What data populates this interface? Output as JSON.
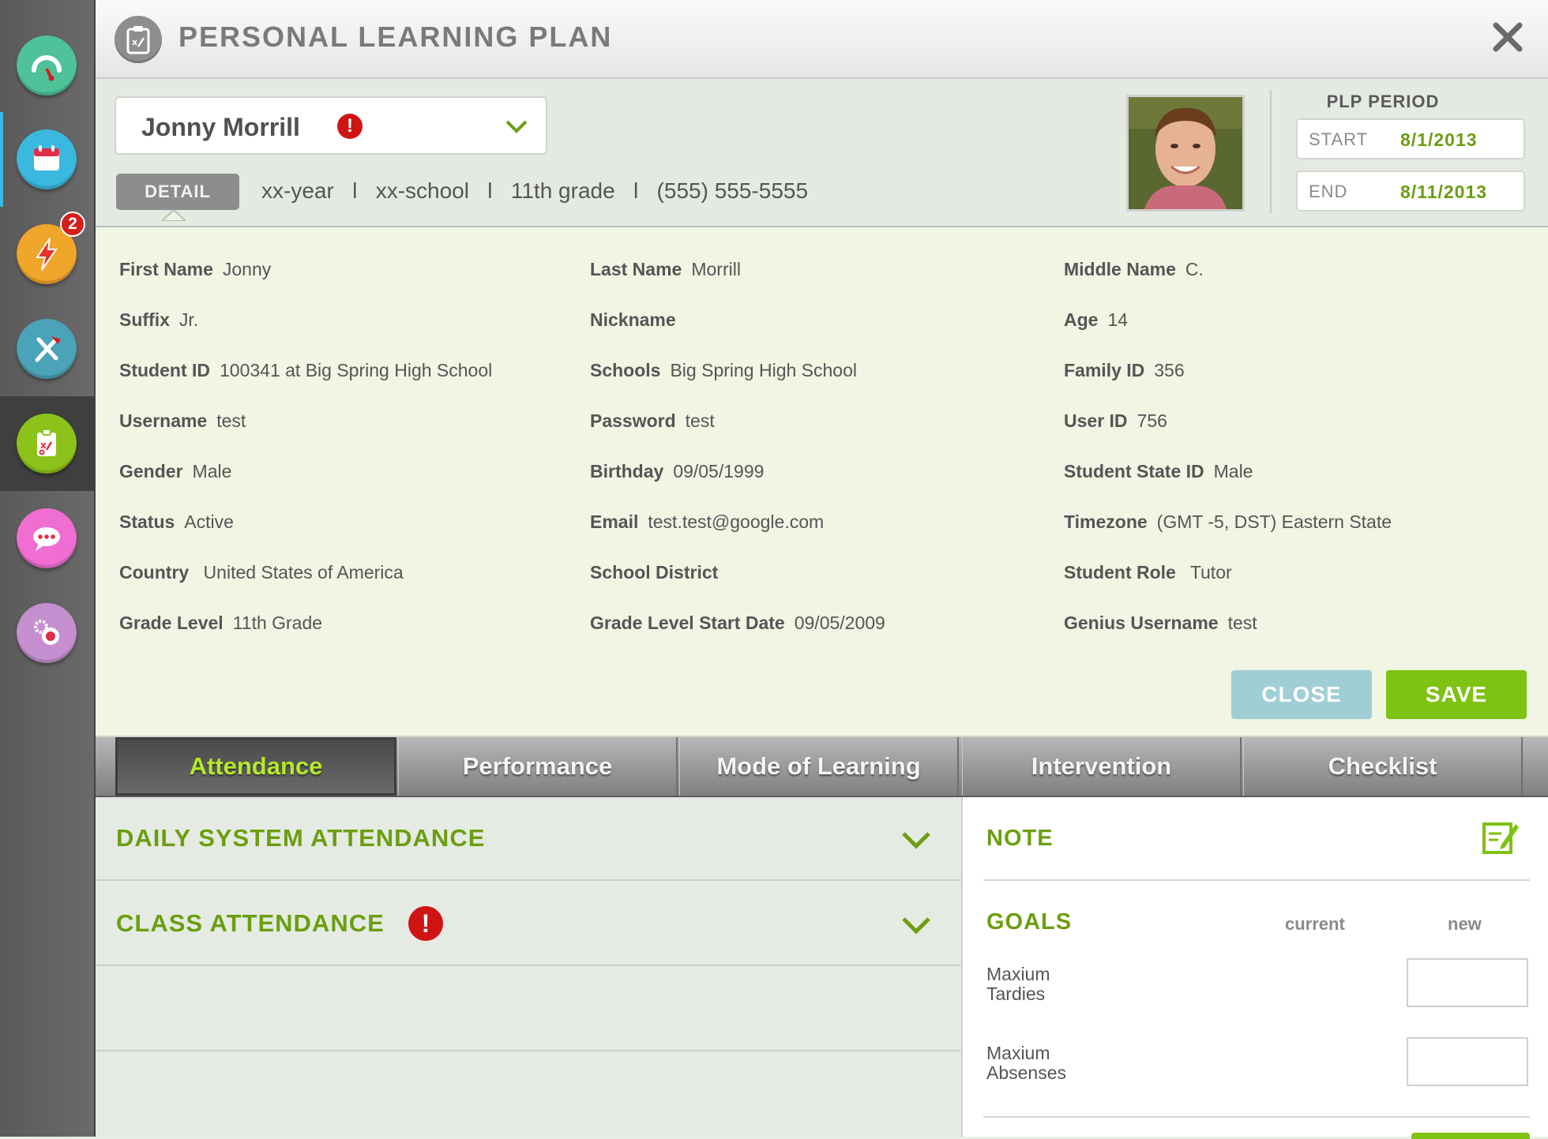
{
  "header": {
    "title": "PERSONAL LEARNING PLAN"
  },
  "sidebar": {
    "items": [
      {
        "name": "dashboard-gauge-icon",
        "color": "#4fc29a"
      },
      {
        "name": "calendar-icon",
        "color": "#3bb8e0"
      },
      {
        "name": "alerts-lightning-icon",
        "color": "#f0a52b",
        "badge": "2"
      },
      {
        "name": "tools-icon",
        "color": "#4aa3b8"
      },
      {
        "name": "plan-clipboard-icon",
        "color": "#8cc21a"
      },
      {
        "name": "chat-icon",
        "color": "#f06ed2"
      },
      {
        "name": "settings-gears-icon",
        "color": "#c58fd0"
      }
    ]
  },
  "student": {
    "name": "Jonny Morrill",
    "alert": "!",
    "detail_label": "DETAIL",
    "summary": "xx-year   l   xx-school   l   11th grade   l   (555) 555-5555"
  },
  "plp_period": {
    "label": "PLP PERIOD",
    "start_label": "START",
    "start_value": "8/1/2013",
    "end_label": "END",
    "end_value": "8/11/2013"
  },
  "details": {
    "fields": [
      {
        "k": "First Name",
        "v": "Jonny"
      },
      {
        "k": "Last Name",
        "v": "Morrill"
      },
      {
        "k": "Middle Name",
        "v": "C."
      },
      {
        "k": "Suffix",
        "v": "Jr."
      },
      {
        "k": "Nickname",
        "v": ""
      },
      {
        "k": "Age",
        "v": "14"
      },
      {
        "k": "Student ID",
        "v": "100341 at Big Spring High School"
      },
      {
        "k": "Schools",
        "v": "Big Spring High School"
      },
      {
        "k": "Family ID",
        "v": "356"
      },
      {
        "k": "Username",
        "v": "test"
      },
      {
        "k": "Password",
        "v": "test"
      },
      {
        "k": "User ID",
        "v": "756"
      },
      {
        "k": "Gender",
        "v": "Male"
      },
      {
        "k": "Birthday",
        "v": "09/05/1999"
      },
      {
        "k": "Student State ID",
        "v": "Male"
      },
      {
        "k": "Status",
        "v": "Active"
      },
      {
        "k": "Email",
        "v": "test.test@google.com"
      },
      {
        "k": "Timezone",
        "v": "(GMT -5, DST) Eastern State"
      },
      {
        "k": "Country",
        "v": " United States of America"
      },
      {
        "k": "School District",
        "v": ""
      },
      {
        "k": "Student Role",
        "v": " Tutor"
      },
      {
        "k": "Grade Level",
        "v": "11th Grade"
      },
      {
        "k": "Grade Level Start Date",
        "v": "09/05/2009"
      },
      {
        "k": "Genius Username",
        "v": "test"
      }
    ],
    "close_label": "CLOSE",
    "save_label": "SAVE"
  },
  "tabs": [
    "Attendance",
    "Performance",
    "Mode of Learning",
    "Intervention",
    "Checklist"
  ],
  "attendance": {
    "daily_title": "DAILY SYSTEM ATTENDANCE",
    "class_title": "CLASS ATTENDANCE",
    "class_alert": "!"
  },
  "note_panel": {
    "note_title": "NOTE",
    "goals_title": "GOALS",
    "current_label": "current",
    "new_label": "new",
    "goals": [
      {
        "label": "Maxium Tardies",
        "new_value": ""
      },
      {
        "label": "Maxium Absenses",
        "new_value": ""
      }
    ]
  }
}
